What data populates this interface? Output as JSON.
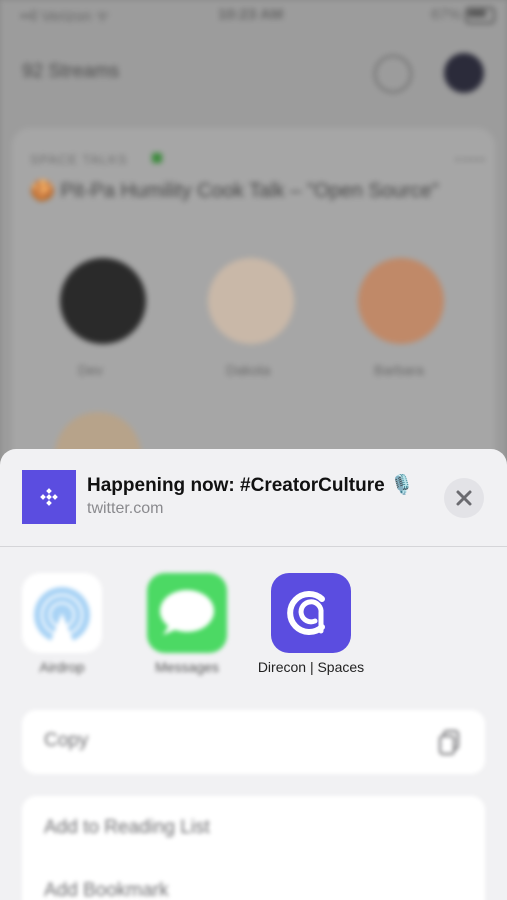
{
  "status_bar": {
    "carrier": "••ll Verizon ᯤ",
    "time": "10:23 AM",
    "battery": "67%"
  },
  "background_app": {
    "title": "92 Streams",
    "card": {
      "live_label": "SPACE TALKS",
      "title": "🍪 Pit-Pa Humility Cook Talk – \"Open Source\"",
      "speakers": [
        {
          "name": "Dev"
        },
        {
          "name": "Dakota"
        },
        {
          "name": "Barbara"
        }
      ]
    }
  },
  "share_sheet": {
    "title": "Happening now: #CreatorCulture 🎙️",
    "subtitle": "twitter.com",
    "apps": [
      {
        "label": "Airdrop",
        "icon": "airdrop-icon"
      },
      {
        "label": "Messages",
        "icon": "messages-icon"
      },
      {
        "label": "Direcon | Spaces",
        "icon": "direcon-spaces-icon"
      }
    ],
    "actions": [
      {
        "label": "Copy",
        "icon": "copy-icon"
      },
      {
        "label": "Add to Reading List",
        "icon": "glasses-icon"
      },
      {
        "label": "Add Bookmark",
        "icon": "book-icon"
      }
    ]
  },
  "colors": {
    "accent": "#5b4de0",
    "sheet_bg": "#f1f1f3",
    "messages_green": "#4cd964"
  }
}
